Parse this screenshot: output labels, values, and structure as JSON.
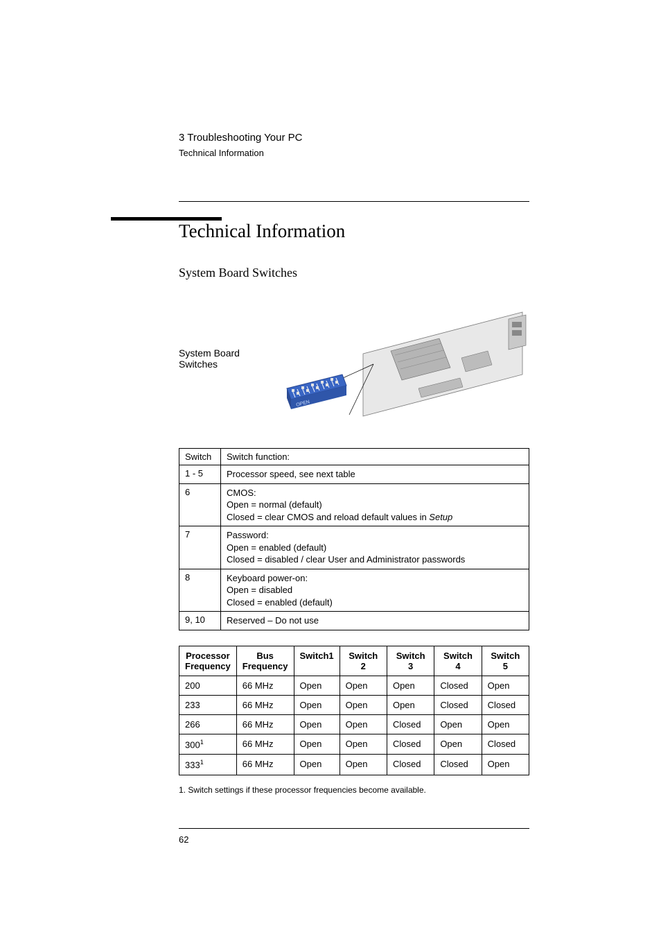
{
  "header": {
    "chapter": "3  Troubleshooting Your PC",
    "section": "Technical Information"
  },
  "title": "Technical Information",
  "subtitle": "System Board Switches",
  "figure_label": "System Board Switches",
  "switch_table": {
    "headers": [
      "Switch",
      "Switch function:"
    ],
    "rows": [
      {
        "sw": "1 - 5",
        "lines": [
          "Processor speed, see next table"
        ]
      },
      {
        "sw": "6",
        "lines": [
          "CMOS:",
          "Open  =  normal (default)",
          "Closed  =  clear CMOS and reload default values in "
        ],
        "trailing_italic": "Setup"
      },
      {
        "sw": "7",
        "lines": [
          "Password:",
          "Open  =  enabled (default)",
          "Closed  =  disabled / clear User and Administrator passwords"
        ]
      },
      {
        "sw": "8",
        "lines": [
          "Keyboard power-on:",
          "Open  =  disabled",
          "Closed  =  enabled (default)"
        ]
      },
      {
        "sw": "9, 10",
        "lines": [
          "Reserved  –  Do not use"
        ]
      }
    ]
  },
  "freq_table": {
    "headers": [
      "Processor Frequency",
      "Bus Frequency",
      "Switch1",
      "Switch 2",
      "Switch 3",
      "Switch 4",
      "Switch 5"
    ],
    "rows": [
      {
        "pf": "200",
        "sup": "",
        "bf": "66 MHz",
        "s1": "Open",
        "s2": "Open",
        "s3": "Open",
        "s4": "Closed",
        "s5": "Open"
      },
      {
        "pf": "233",
        "sup": "",
        "bf": "66 MHz",
        "s1": "Open",
        "s2": "Open",
        "s3": "Open",
        "s4": "Closed",
        "s5": "Closed"
      },
      {
        "pf": "266",
        "sup": "",
        "bf": "66 MHz",
        "s1": "Open",
        "s2": "Open",
        "s3": "Closed",
        "s4": "Open",
        "s5": "Open"
      },
      {
        "pf": "300",
        "sup": "1",
        "bf": "66 MHz",
        "s1": "Open",
        "s2": "Open",
        "s3": "Closed",
        "s4": "Open",
        "s5": "Closed"
      },
      {
        "pf": "333",
        "sup": "1",
        "bf": "66 MHz",
        "s1": "Open",
        "s2": "Open",
        "s3": "Closed",
        "s4": "Closed",
        "s5": "Open"
      }
    ]
  },
  "footnote": "1.      Switch settings if these processor frequencies become available.",
  "page_number": "62"
}
